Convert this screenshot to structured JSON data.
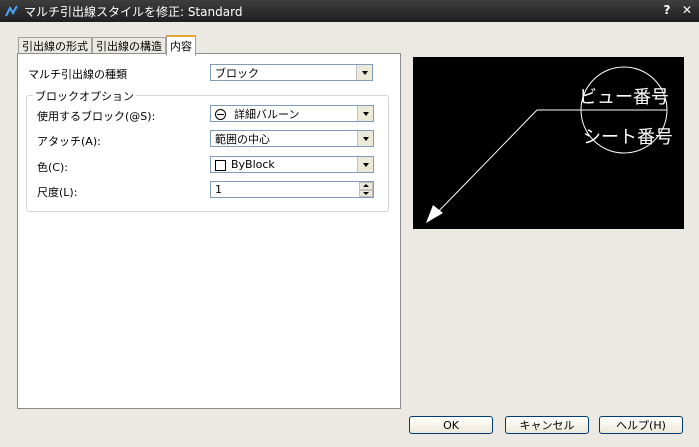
{
  "window": {
    "title": "マルチ引出線スタイルを修正: Standard",
    "help_button": "?",
    "close_button": "✕"
  },
  "tabs": [
    {
      "label": "引出線の形式",
      "active": false
    },
    {
      "label": "引出線の構造",
      "active": false
    },
    {
      "label": "内容",
      "active": true
    }
  ],
  "content": {
    "leader_type_label": "マルチ引出線の種類",
    "leader_type_value": "ブロック",
    "block_options": {
      "group_title": "ブロックオプション",
      "source_block_label": "使用するブロック(@S):",
      "source_block_value": "詳細バルーン",
      "attach_label": "アタッチ(A):",
      "attach_value": "範囲の中心",
      "color_label": "色(C):",
      "color_value": "ByBlock",
      "scale_label": "尺度(L):",
      "scale_value": "1"
    }
  },
  "preview": {
    "top_text": "ビュー番号",
    "bottom_text": "シート番号"
  },
  "buttons": {
    "ok": "OK",
    "cancel": "キャンセル",
    "help": "ヘルプ(H)"
  }
}
